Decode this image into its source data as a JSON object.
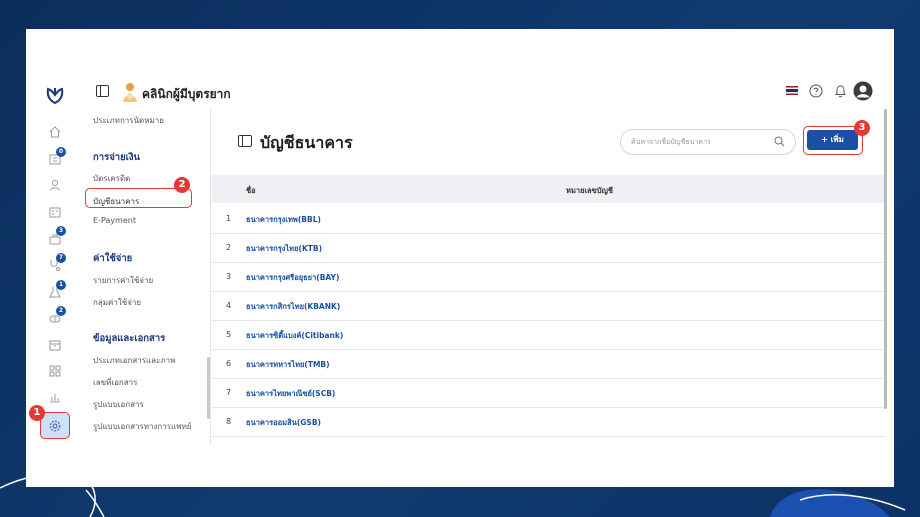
{
  "app": {
    "clinic_name": "คลินิกผู้มีบุตรยาก"
  },
  "sidebar": {
    "badges": [
      "0",
      "3",
      "7",
      "1",
      "2"
    ]
  },
  "menu": {
    "items": [
      {
        "label": "ประเภทการนัดหมาย",
        "kind": "item"
      },
      {
        "label": "การจ่ายเงิน",
        "kind": "head"
      },
      {
        "label": "บัตรเครดิต",
        "kind": "item"
      },
      {
        "label": "บัญชีธนาคาร",
        "kind": "item"
      },
      {
        "label": "E-Payment",
        "kind": "item"
      },
      {
        "label": "ค่าใช้จ่าย",
        "kind": "head"
      },
      {
        "label": "รายการค่าใช้จ่าย",
        "kind": "item"
      },
      {
        "label": "กลุ่มค่าใช้จ่าย",
        "kind": "item"
      },
      {
        "label": "ข้อมูลและเอกสาร",
        "kind": "head"
      },
      {
        "label": "ประเภทเอกสารและภาพ",
        "kind": "item"
      },
      {
        "label": "เลขที่เอกสาร",
        "kind": "item"
      },
      {
        "label": "รูปแบบเอกสาร",
        "kind": "item"
      },
      {
        "label": "รูปแบบเอกสารทางการแพทย์",
        "kind": "item"
      }
    ]
  },
  "main": {
    "title": "บัญชีธนาคาร",
    "search_placeholder": "ค้นหาจากชื่อบัญชีธนาคาร",
    "add_label": "+ เพิ่ม",
    "columns": [
      "ชื่อ",
      "หมายเลขบัญชี"
    ],
    "rows": [
      {
        "num": "1",
        "name": "ธนาคารกรุงเทพ(BBL)"
      },
      {
        "num": "2",
        "name": "ธนาคารกรุงไทย(KTB)"
      },
      {
        "num": "3",
        "name": "ธนาคารกรุงศรีอยุธยา(BAY)"
      },
      {
        "num": "4",
        "name": "ธนาคารกสิกรไทย(KBANK)"
      },
      {
        "num": "5",
        "name": "ธนาคารซิตี้แบงค์(Citibank)"
      },
      {
        "num": "6",
        "name": "ธนาคารทหารไทย(TMB)"
      },
      {
        "num": "7",
        "name": "ธนาคารไทยพาณิชย์(SCB)"
      },
      {
        "num": "8",
        "name": "ธนาคารออมสิน(GSB)"
      }
    ]
  },
  "steps": [
    "1",
    "2",
    "3"
  ],
  "colors": {
    "accent": "#1a4fa3",
    "highlight": "#e53935",
    "background": "#0b2e5c"
  }
}
